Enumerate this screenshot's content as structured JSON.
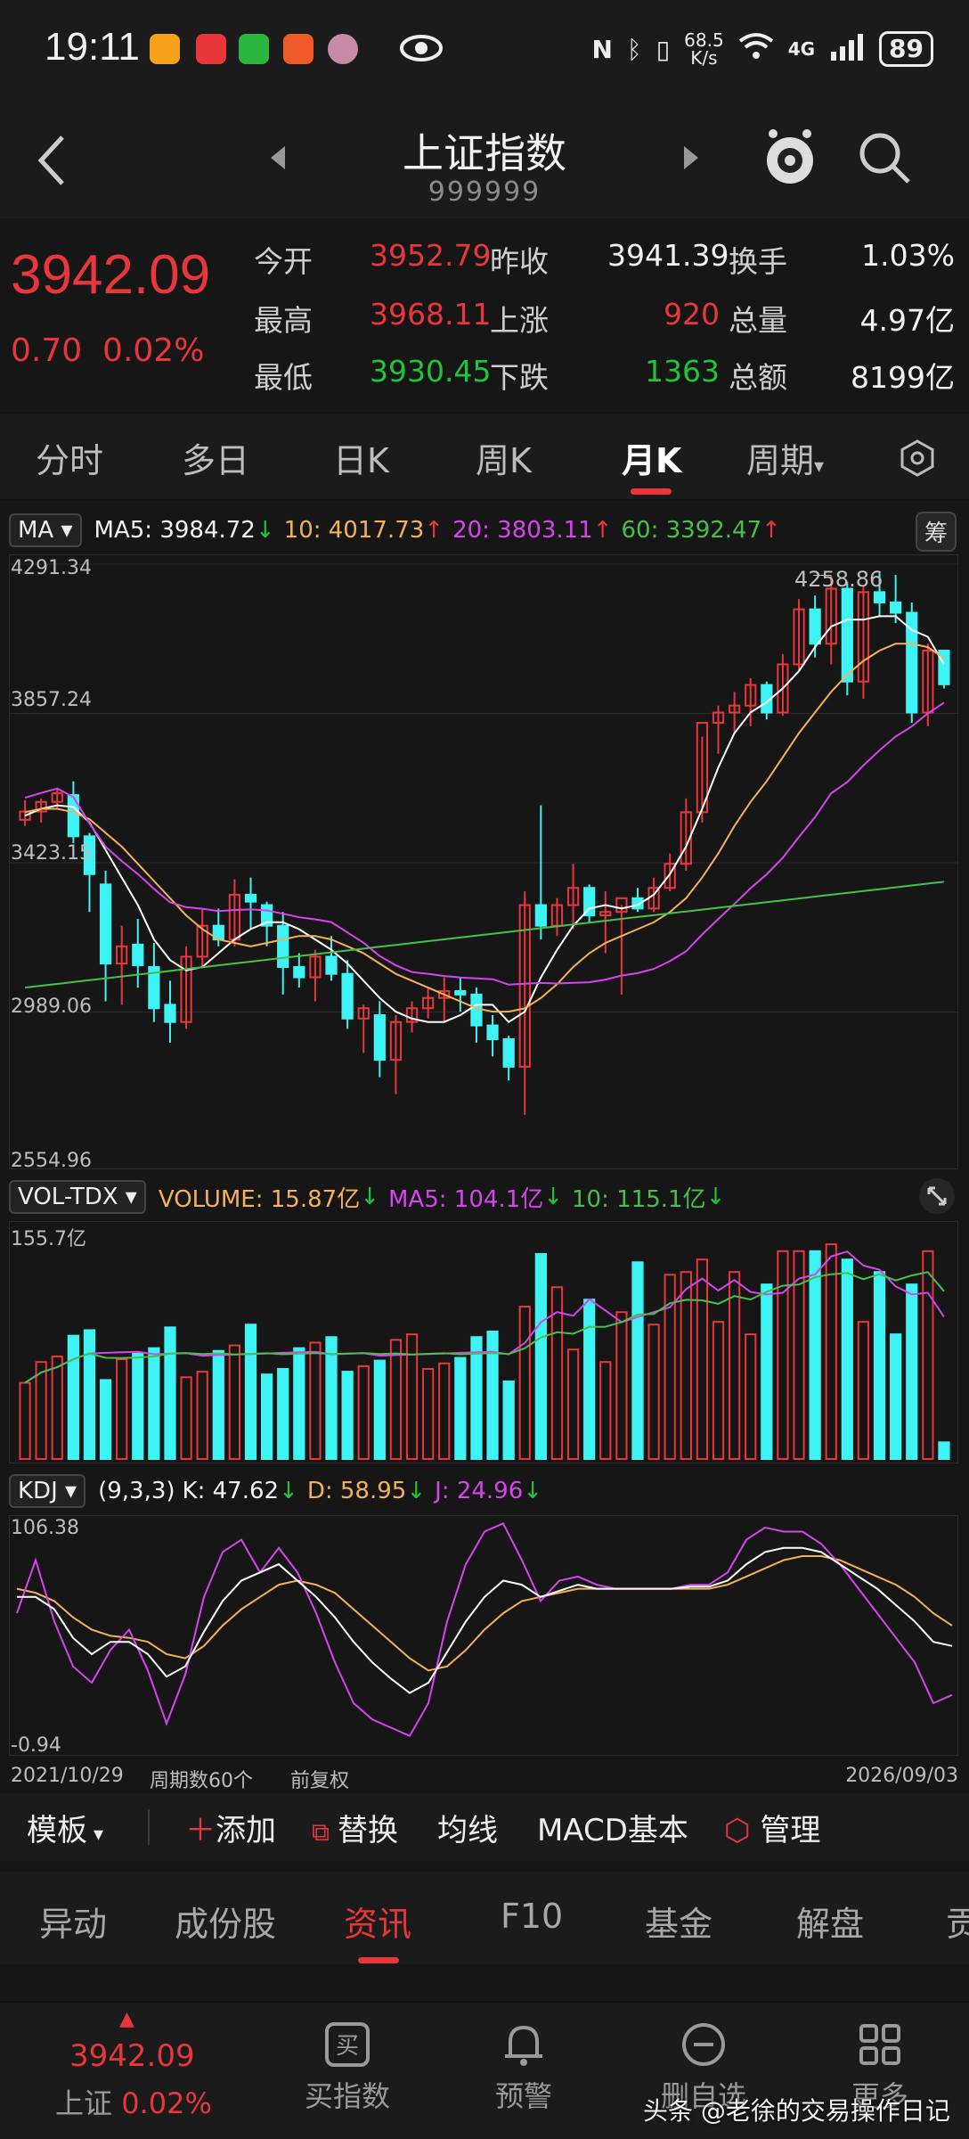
{
  "status": {
    "time": "19:11",
    "net_speed_top": "68.5",
    "net_speed_bottom": "K/s",
    "battery": "89",
    "signal": "4G"
  },
  "header": {
    "title": "上证指数",
    "code": "999999"
  },
  "quote": {
    "price": "3942.09",
    "change": "0.70",
    "change_pct": "0.02%",
    "open_label": "今开",
    "open": "3952.79",
    "prev_close_label": "昨收",
    "prev_close": "3941.39",
    "turnover_label": "换手",
    "turnover": "1.03%",
    "high_label": "最高",
    "high": "3968.11",
    "up_label": "上涨",
    "up": "920",
    "volume_label": "总量",
    "volume": "4.97亿",
    "low_label": "最低",
    "low": "3930.45",
    "down_label": "下跌",
    "down": "1363",
    "amount_label": "总额",
    "amount": "8199亿"
  },
  "period_tabs": [
    "分时",
    "多日",
    "日K",
    "周K",
    "月K",
    "周期"
  ],
  "active_period": "月K",
  "ma_row": {
    "button": "MA",
    "ma5": "MA5: 3984.72",
    "ma10": "10: 4017.73",
    "ma20": "20: 3803.11",
    "ma60": "60: 3392.47",
    "right_button": "筹"
  },
  "kline_axis": {
    "y1": "4291.34",
    "y2": "3857.24",
    "y3": "3423.15",
    "y4": "2989.06",
    "y5": "2554.96",
    "high_marker": "4258.86"
  },
  "vol_row": {
    "button": "VOL-TDX",
    "volume": "VOLUME: 15.87亿",
    "ma5": "MA5: 104.1亿",
    "ma10": "10: 115.1亿",
    "axis_top": "155.7亿"
  },
  "kdj_row": {
    "button": "KDJ",
    "params": "(9,3,3)",
    "k": "K: 47.62",
    "d": "D: 58.95",
    "j": "J: 24.96",
    "axis_top": "106.38",
    "axis_bottom": "-0.94"
  },
  "bottom_axis": {
    "start_date": "2021/10/29",
    "count": "周期数60个",
    "adjust": "前复权",
    "end_date": "2026/09/03"
  },
  "tools": {
    "template": "模板",
    "add": "添加",
    "replace": "替换",
    "ma": "均线",
    "macd": "MACD基本",
    "manage": "管理"
  },
  "news_tabs": [
    "异动",
    "成份股",
    "资讯",
    "F10",
    "基金",
    "解盘",
    "贡"
  ],
  "active_news": "资讯",
  "bottom_bar": {
    "price": "3942.09",
    "name": "上证",
    "pct": "0.02%",
    "buy": "买指数",
    "alert": "预警",
    "watch": "删自选",
    "more": "更多",
    "watermark": "头条 @老徐的交易操作日记"
  },
  "colors": {
    "up": "#e8373a",
    "down": "#3ef3f3",
    "ma5": "#ffffff",
    "ma10": "#f5b158",
    "ma20": "#d744ee",
    "ma60": "#48c048",
    "green_text": "#1fc43a"
  },
  "chart_data": {
    "type": "candlestick",
    "title": "上证指数 月K",
    "x_start": "2021/10/29",
    "x_end": "2026/09/03",
    "periods": 60,
    "ylim": [
      2554.96,
      4291.34
    ],
    "candles": [
      [
        3548,
        3605,
        3530,
        3572
      ],
      [
        3572,
        3610,
        3540,
        3600
      ],
      [
        3600,
        3640,
        3580,
        3625
      ],
      [
        3620,
        3660,
        3480,
        3500
      ],
      [
        3500,
        3510,
        3280,
        3390
      ],
      [
        3360,
        3400,
        3020,
        3130
      ],
      [
        3130,
        3240,
        3010,
        3180
      ],
      [
        3185,
        3260,
        3060,
        3125
      ],
      [
        3120,
        3190,
        2960,
        3000
      ],
      [
        3010,
        3080,
        2900,
        2960
      ],
      [
        2960,
        3180,
        2940,
        3150
      ],
      [
        3150,
        3290,
        3120,
        3240
      ],
      [
        3240,
        3290,
        3180,
        3200
      ],
      [
        3200,
        3375,
        3180,
        3330
      ],
      [
        3330,
        3380,
        3230,
        3310
      ],
      [
        3300,
        3310,
        3180,
        3240
      ],
      [
        3240,
        3280,
        3040,
        3120
      ],
      [
        3120,
        3160,
        3060,
        3090
      ],
      [
        3090,
        3170,
        3020,
        3150
      ],
      [
        3150,
        3210,
        3080,
        3100
      ],
      [
        3100,
        3140,
        2940,
        2970
      ],
      [
        2970,
        3010,
        2870,
        3000
      ],
      [
        2980,
        3020,
        2800,
        2850
      ],
      [
        2850,
        2980,
        2750,
        2960
      ],
      [
        2960,
        3020,
        2930,
        3000
      ],
      [
        3000,
        3060,
        2970,
        3030
      ],
      [
        3030,
        3090,
        2960,
        3050
      ],
      [
        3050,
        3090,
        2990,
        3040
      ],
      [
        3040,
        3060,
        2900,
        2950
      ],
      [
        2950,
        2980,
        2860,
        2910
      ],
      [
        2910,
        2920,
        2790,
        2830
      ],
      [
        2830,
        3340,
        2690,
        3300
      ],
      [
        3300,
        3590,
        3200,
        3240
      ],
      [
        3240,
        3320,
        3210,
        3300
      ],
      [
        3300,
        3420,
        3230,
        3350
      ],
      [
        3350,
        3360,
        3250,
        3270
      ],
      [
        3270,
        3340,
        3160,
        3280
      ],
      [
        3280,
        3300,
        3040,
        3320
      ],
      [
        3320,
        3350,
        3280,
        3290
      ],
      [
        3290,
        3380,
        3280,
        3350
      ],
      [
        3350,
        3450,
        3340,
        3420
      ],
      [
        3420,
        3610,
        3400,
        3570
      ],
      [
        3570,
        3790,
        3540,
        3830
      ],
      [
        3830,
        3880,
        3740,
        3860
      ],
      [
        3860,
        3920,
        3800,
        3880
      ],
      [
        3880,
        3960,
        3820,
        3940
      ],
      [
        3940,
        3950,
        3840,
        3860
      ],
      [
        3860,
        4030,
        3850,
        4000
      ],
      [
        4000,
        4190,
        3980,
        4160
      ],
      [
        4160,
        4200,
        4020,
        4060
      ],
      [
        4060,
        4258.86,
        4000,
        4220
      ],
      [
        4220,
        4240,
        3910,
        3950
      ],
      [
        3950,
        4230,
        3900,
        4210
      ],
      [
        4210,
        4270,
        4140,
        4180
      ],
      [
        4180,
        4260,
        4120,
        4150
      ],
      [
        4150,
        4180,
        3830,
        3860
      ],
      [
        3860,
        4060,
        3820,
        4040
      ],
      [
        4040,
        4040,
        3930,
        3942
      ]
    ],
    "ma_lines": {
      "MA5": [
        3560,
        3580,
        3590,
        3585,
        3540,
        3460,
        3380,
        3300,
        3200,
        3140,
        3110,
        3120,
        3160,
        3200,
        3230,
        3250,
        3250,
        3230,
        3200,
        3170,
        3130,
        3080,
        3030,
        2990,
        2970,
        2960,
        2960,
        2980,
        3010,
        3010,
        2960,
        2990,
        3090,
        3170,
        3240,
        3290,
        3300,
        3290,
        3300,
        3330,
        3390,
        3470,
        3580,
        3700,
        3800,
        3860,
        3890,
        3930,
        3980,
        4050,
        4110,
        4130,
        4130,
        4140,
        4140,
        4100,
        4080,
        4000
      ],
      "MA10": [
        3570,
        3580,
        3580,
        3570,
        3550,
        3510,
        3470,
        3420,
        3370,
        3320,
        3270,
        3230,
        3200,
        3190,
        3180,
        3190,
        3200,
        3210,
        3210,
        3200,
        3180,
        3160,
        3130,
        3100,
        3080,
        3060,
        3040,
        3020,
        3000,
        2990,
        2990,
        3000,
        3030,
        3070,
        3120,
        3160,
        3190,
        3210,
        3230,
        3250,
        3280,
        3320,
        3380,
        3450,
        3530,
        3600,
        3660,
        3730,
        3800,
        3860,
        3920,
        3970,
        4010,
        4040,
        4060,
        4060,
        4050,
        4018
      ]
    }
  }
}
